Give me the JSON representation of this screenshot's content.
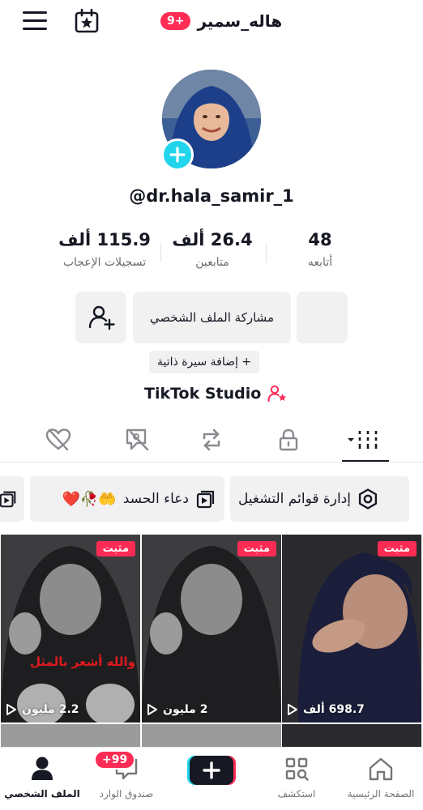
{
  "header": {
    "title": "هاله_سمير",
    "notification_badge": "9+",
    "menu_icon": "hamburger-menu-icon",
    "calendar_icon": "calendar-star-icon"
  },
  "profile": {
    "handle": "@dr.hala_samir_1",
    "avatar_icon": "profile-photo",
    "add_icon": "plus-icon"
  },
  "stats": {
    "likes": {
      "value": "115.9 ألف",
      "label": "تسجيلات الإعجاب"
    },
    "followers": {
      "value": "26.4 ألف",
      "label": "متابعين"
    },
    "following": {
      "value": "48",
      "label": "أتابعه"
    }
  },
  "actions": {
    "share_profile": "مشاركة الملف الشخصي",
    "add_friend_icon": "add-user-icon"
  },
  "bio": {
    "add_bio": "+ إضافة سيرة ذاتية"
  },
  "studio": {
    "label": "TikTok Studio"
  },
  "tabs": [
    "grid-icon",
    "lock-icon",
    "repost-icon",
    "tagged-icon",
    "liked-icon"
  ],
  "playlists": [
    {
      "label": "إدارة قوائم التشغيل",
      "icon": "gear-icon"
    },
    {
      "label": "دعاء الحسد",
      "icon": "playlist-icon",
      "emoji": "🤲🥀❤️"
    }
  ],
  "videos": [
    {
      "pinned": "مثبت",
      "views": "698.7 ألف"
    },
    {
      "pinned": "مثبت",
      "views": "2 مليون"
    },
    {
      "pinned": "مثبت",
      "views": "2.2 مليون",
      "caption": "والله أشعر بالمثل"
    }
  ],
  "bottom_nav": {
    "home": "الصفحة الرئيسية",
    "discover": "استكشف",
    "inbox": "صندوق الوارد",
    "inbox_badge": "+99",
    "profile": "الملف الشخصي"
  },
  "colors": {
    "accent": "#fe2c55",
    "cyan": "#20d5ec"
  }
}
